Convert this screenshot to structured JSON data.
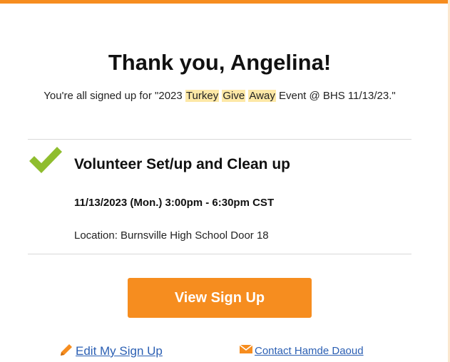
{
  "page": {
    "accent_color": "#f68d1f",
    "highlight_color": "#fde8a6",
    "link_color": "#2b5fb3",
    "check_color": "#8fbd2e"
  },
  "header": {
    "title": "Thank you, Angelina!",
    "subtitle": {
      "prefix": "You're all signed up for \"2023 ",
      "highlighted_words": [
        "Turkey",
        "Give",
        "Away"
      ],
      "suffix": " Event @ BHS 11/13/23.\""
    }
  },
  "signup_slot": {
    "icon": "checkmark-icon",
    "title": "Volunteer Set/up and Clean up",
    "datetime": "11/13/2023 (Mon.) 3:00pm - 6:30pm CST",
    "location": "Location: Burnsville High School Door 18"
  },
  "actions": {
    "view_signup_label": "View Sign Up",
    "edit_signup": {
      "icon": "pencil-icon",
      "label": "Edit My Sign Up"
    },
    "contact": {
      "icon": "envelope-icon",
      "label": "Contact Hamde Daoud"
    }
  }
}
